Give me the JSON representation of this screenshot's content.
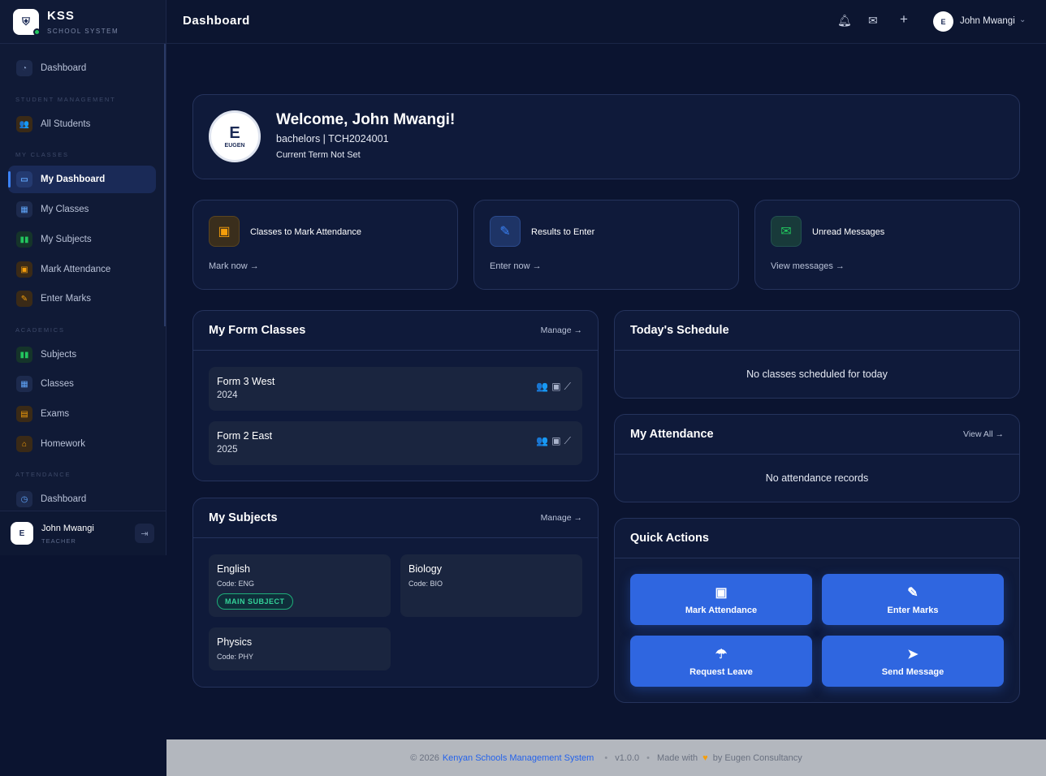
{
  "brand": {
    "name": "KSS",
    "subtitle": "SCHOOL SYSTEM",
    "logo_icon": "school-crest-icon"
  },
  "sidebar": {
    "sections": [
      "STUDENT MANAGEMENT",
      "MY CLASSES",
      "ACADEMICS",
      "ATTENDANCE"
    ],
    "items": [
      {
        "label": "Dashboard",
        "icon": "gauge-icon",
        "color": "#8aa0c8"
      },
      {
        "label": "All Students",
        "icon": "users-icon",
        "color": "#f59e0b"
      },
      {
        "label": "My Dashboard",
        "icon": "laptop-icon",
        "color": "#60a5fa"
      },
      {
        "label": "My Classes",
        "icon": "building-icon",
        "color": "#60a5fa"
      },
      {
        "label": "My Subjects",
        "icon": "book-icon",
        "color": "#22c55e"
      },
      {
        "label": "Mark Attendance",
        "icon": "calendar-check-icon",
        "color": "#f59e0b"
      },
      {
        "label": "Enter Marks",
        "icon": "pencil-icon",
        "color": "#f59e0b"
      },
      {
        "label": "Subjects",
        "icon": "book-icon",
        "color": "#22c55e"
      },
      {
        "label": "Classes",
        "icon": "building-icon",
        "color": "#60a5fa"
      },
      {
        "label": "Exams",
        "icon": "file-icon",
        "color": "#f59e0b"
      },
      {
        "label": "Homework",
        "icon": "home-icon",
        "color": "#f59e0b"
      },
      {
        "label": "Dashboard",
        "icon": "clock-icon",
        "color": "#60a5fa"
      }
    ],
    "user": {
      "name": "John Mwangi",
      "role": "TEACHER",
      "initials": "E"
    }
  },
  "topbar": {
    "title": "Dashboard",
    "user_name": "John Mwangi",
    "avatar_initials": "E"
  },
  "welcome": {
    "title": "Welcome, John Mwangi!",
    "line1": "bachelors | TCH2024001",
    "line2": "Current Term Not Set",
    "logo_text": "E",
    "logo_label": "EUGEN"
  },
  "stats": [
    {
      "label": "Classes to Mark Attendance",
      "link": "Mark now",
      "icon": "calendar-check-icon",
      "color": "#f59e0b"
    },
    {
      "label": "Results to Enter",
      "link": "Enter now",
      "icon": "pencil-icon",
      "color": "#3b82f6"
    },
    {
      "label": "Unread Messages",
      "link": "View messages",
      "icon": "envelope-icon",
      "color": "#22c55e"
    }
  ],
  "form_classes": {
    "title": "My Form Classes",
    "link": "Manage",
    "items": [
      {
        "name": "Form 3 West",
        "year": "2024"
      },
      {
        "name": "Form 2 East",
        "year": "2025"
      }
    ]
  },
  "schedule": {
    "title": "Today's Schedule",
    "empty": "No classes scheduled for today"
  },
  "attendance": {
    "title": "My Attendance",
    "link": "View All",
    "empty": "No attendance records"
  },
  "subjects": {
    "title": "My Subjects",
    "link": "Manage",
    "items": [
      {
        "name": "English",
        "code": "Code: ENG",
        "badge": "MAIN SUBJECT"
      },
      {
        "name": "Biology",
        "code": "Code: BIO"
      },
      {
        "name": "Physics",
        "code": "Code: PHY"
      }
    ]
  },
  "quick_actions": {
    "title": "Quick Actions",
    "items": [
      {
        "label": "Mark Attendance",
        "icon": "calendar-check-icon"
      },
      {
        "label": "Enter Marks",
        "icon": "pencil-icon"
      },
      {
        "label": "Request Leave",
        "icon": "umbrella-beach-icon"
      },
      {
        "label": "Send Message",
        "icon": "paper-plane-icon"
      }
    ]
  },
  "footer": {
    "copyright": "© 2026",
    "org": "Kenyan Schools Management System",
    "version": "v1.0.0",
    "made_with": "Made with",
    "by": "by Eugen Consultancy",
    "heart": "♥"
  }
}
